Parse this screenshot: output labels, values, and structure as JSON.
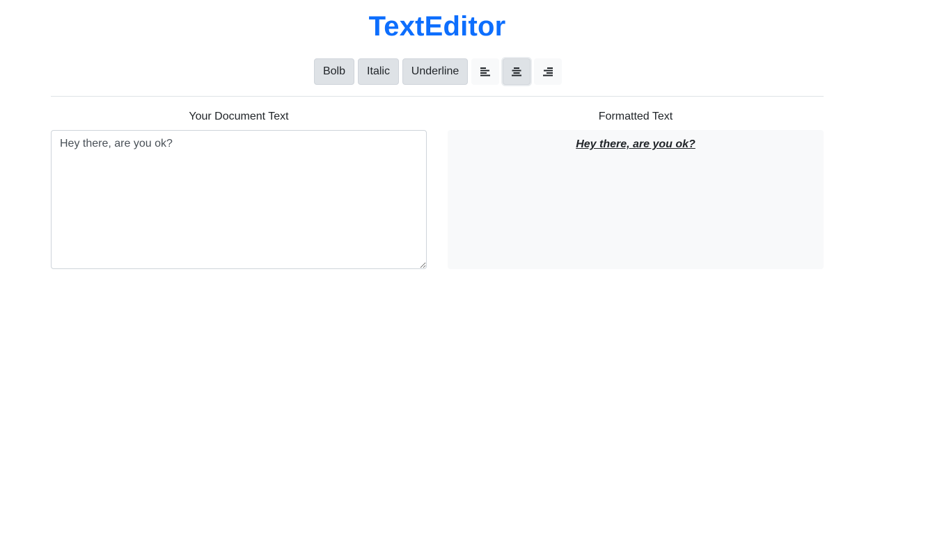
{
  "app": {
    "title": "TextEditor",
    "accent_color": "#0d6efd"
  },
  "toolbar": {
    "bold_label": "Bolb",
    "italic_label": "Italic",
    "underline_label": "Underline",
    "align_left_icon": "align-left-icon",
    "align_center_icon": "align-center-icon",
    "align_right_icon": "align-right-icon",
    "active_alignment": "center"
  },
  "editor": {
    "input_label": "Your Document Text",
    "input_value": "Hey there, are you ok?",
    "output_label": "Formatted Text",
    "output_text": "Hey there, are you ok?",
    "output_styles": [
      "bold",
      "italic",
      "underline"
    ]
  }
}
